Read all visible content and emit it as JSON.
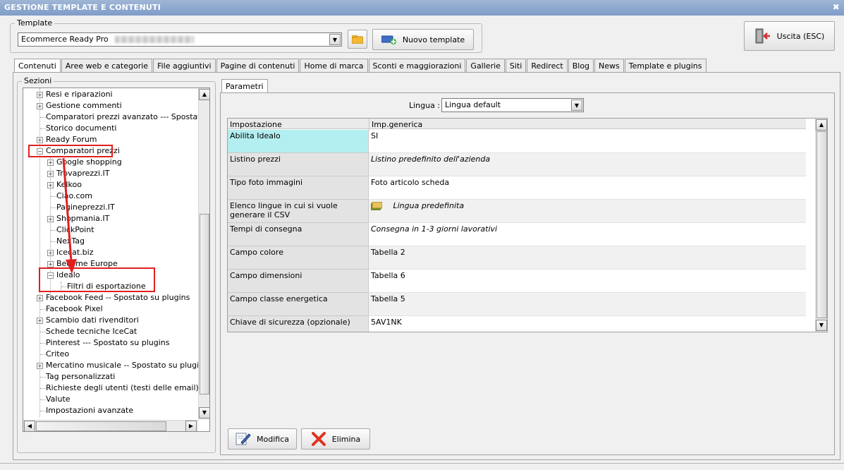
{
  "window": {
    "title": "GESTIONE TEMPLATE E CONTENUTI",
    "close": "✖"
  },
  "template": {
    "group_label": "Template",
    "selected": "Ecommerce Ready Pro",
    "new_template": "Nuovo template"
  },
  "exit_button": "Uscita (ESC)",
  "tabs": [
    "Contenuti",
    "Aree web e categorie",
    "File aggiuntivi",
    "Pagine di contenuti",
    "Home di marca",
    "Sconti e maggiorazioni",
    "Gallerie",
    "Siti",
    "Redirect",
    "Blog",
    "News",
    "Template e plugins"
  ],
  "sections": {
    "label": "Sezioni",
    "items": [
      "Resi e riparazioni",
      "Gestione commenti",
      "Comparatori prezzi avanzato --- Spostato su",
      "Storico documenti",
      "Ready Forum",
      "Comparatori prezzi",
      "Google shopping",
      "Trovaprezzi.IT",
      "Kelkoo",
      "Ciao.com",
      "Pagineprezzi.IT",
      "Shopmania.IT",
      "ClickPoint",
      "NexTag",
      "Icecat.biz",
      "Become Europe",
      "Idealo",
      "Filtri di esportazione",
      "Facebook Feed -- Spostato su plugins",
      "Facebook Pixel",
      "Scambio dati rivenditori",
      "Schede tecniche IceCat",
      "Pinterest --- Spostato su plugins",
      "Criteo",
      "Mercatino musicale -- Spostato su plugins",
      "Tag personalizzati",
      "Richieste degli utenti (testi delle email)",
      "Valute",
      "Impostazioni avanzate"
    ]
  },
  "params": {
    "tab": "Parametri",
    "lingua_label": "Lingua :",
    "lingua_value": "Lingua default",
    "col_setting": "Impostazione",
    "col_value": "Imp.generica",
    "rows": [
      {
        "k": "Abilita Idealo",
        "v": "SI"
      },
      {
        "k": "Listino prezzi",
        "v": "Listino predefinito dell'azienda"
      },
      {
        "k": "Tipo foto immagini",
        "v": "Foto articolo scheda"
      },
      {
        "k": "Elenco lingue in cui si vuole generare il CSV",
        "v": "Lingua predefinita"
      },
      {
        "k": "Tempi di consegna",
        "v": "Consegna in 1-3 giorni lavorativi"
      },
      {
        "k": "Campo colore",
        "v": "Tabella 2"
      },
      {
        "k": "Campo dimensioni",
        "v": "Tabella 6"
      },
      {
        "k": "Campo classe energetica",
        "v": "Tabella 5"
      },
      {
        "k": "Chiave di sicurezza (opzionale)",
        "v": "5AV1NK"
      }
    ]
  },
  "actions": {
    "edit": "Modifica",
    "delete": "Elimina"
  },
  "colors": {
    "highlight_red": "#e02020",
    "selected_cell": "#b3eef0",
    "titlebar": "#8aa6cf"
  }
}
